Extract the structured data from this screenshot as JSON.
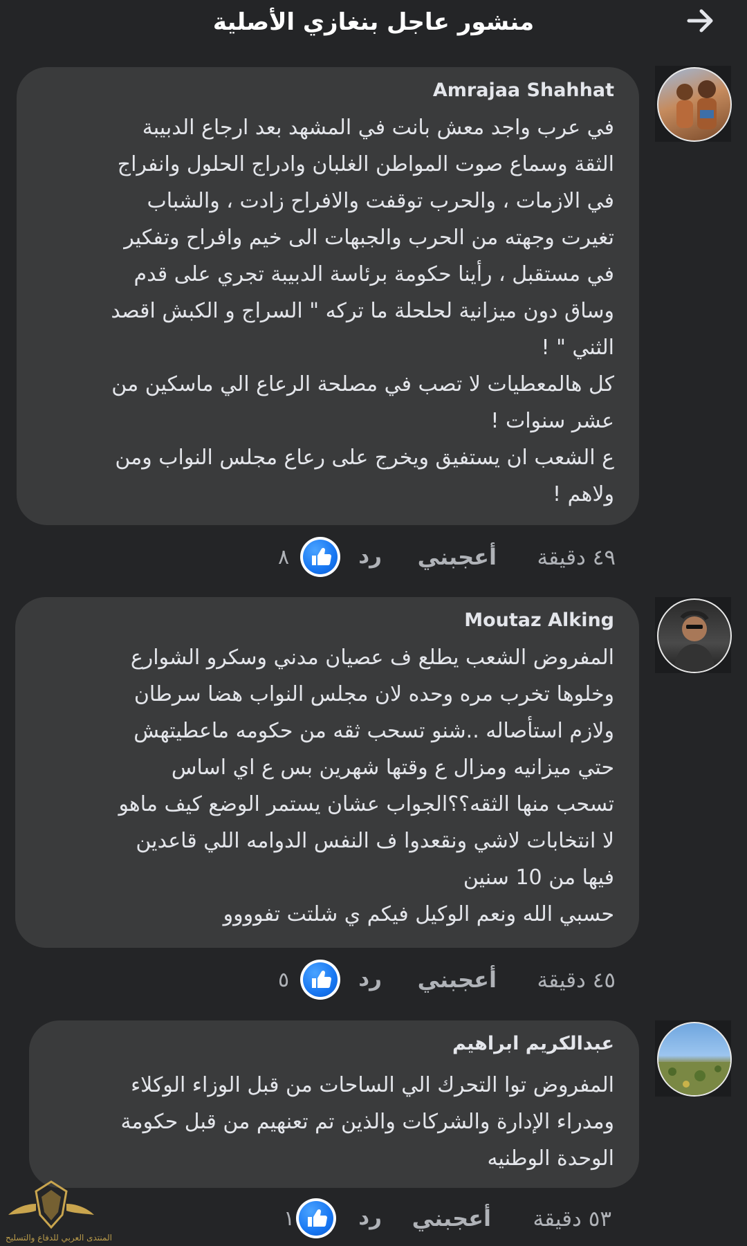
{
  "header": {
    "title": "منشور عاجل بنغازي الأصلية",
    "back_icon": "arrow-right-icon"
  },
  "comments": [
    {
      "author": "Amrajaa Shahhat",
      "lines": [
        "في عرب واجد معش بانت في المشهد بعد ارجاع الدبيبة",
        "الثقة وسماع صوت المواطن الغلبان وادراج الحلول وانفراج",
        "في الازمات ، والحرب توقفت والافراح زادت ، والشباب",
        "تغيرت وجهته من الحرب والجبهات الى خيم وافراح وتفكير",
        "في مستقبل ، رأينا حكومة برئاسة الدبيبة تجري على قدم",
        "وساق دون ميزانية لحلحلة ما تركه \" السراج و الكبش اقصد",
        "الثني \" !",
        "كل هالمعطيات لا تصب في مصلحة الرعاع الي ماسكين من",
        "عشر سنوات !",
        "ع الشعب ان يستفيق ويخرج على رعاع مجلس النواب ومن",
        "ولاهم !"
      ],
      "time": "٤٩ دقيقة",
      "like_label": "أعجبني",
      "reply_label": "رد",
      "like_count": "٨"
    },
    {
      "author": "Moutaz Alking",
      "lines": [
        "المفروض الشعب يطلع ف عصيان مدني وسكرو الشوارع",
        "وخلوها تخرب مره وحده لان مجلس النواب هضا سرطان",
        "ولازم استأصاله ..شنو تسحب ثقه من حكومه ماعطيتهش",
        "حتي ميزانيه  ومزال ع وقتها شهرين بس ع اي اساس",
        "تسحب منها الثقه؟؟الجواب عشان يستمر الوضع كيف ماهو",
        "لا انتخابات لاشي ونقعدوا ف النفس الدوامه اللي قاعدين",
        "فيها من 10 سنين",
        "حسبي الله ونعم الوكيل فيكم ي شلتت تفوووو"
      ],
      "time": "٤٥ دقيقة",
      "like_label": "أعجبني",
      "reply_label": "رد",
      "like_count": "٥"
    },
    {
      "author": "عبدالكريم ابراهيم",
      "lines": [
        "المفروض توا التحرك الي الساحات من قبل الوزاء  الوكلاء",
        "ومدراء الإدارة والشركات والذين تم تعنهيم  من قبل حكومة",
        "الوحدة الوطنيه"
      ],
      "time": "٥٣ دقيقة",
      "like_label": "أعجبني",
      "reply_label": "رد",
      "like_count": "١"
    }
  ],
  "watermark": {
    "text": "المنتدى العربي للدفاع والتسليح"
  },
  "colors": {
    "background": "#242527",
    "bubble": "#3a3b3c",
    "text": "#e4e6eb",
    "secondary_text": "#b0b3b8",
    "like_blue": "#1877f2"
  }
}
